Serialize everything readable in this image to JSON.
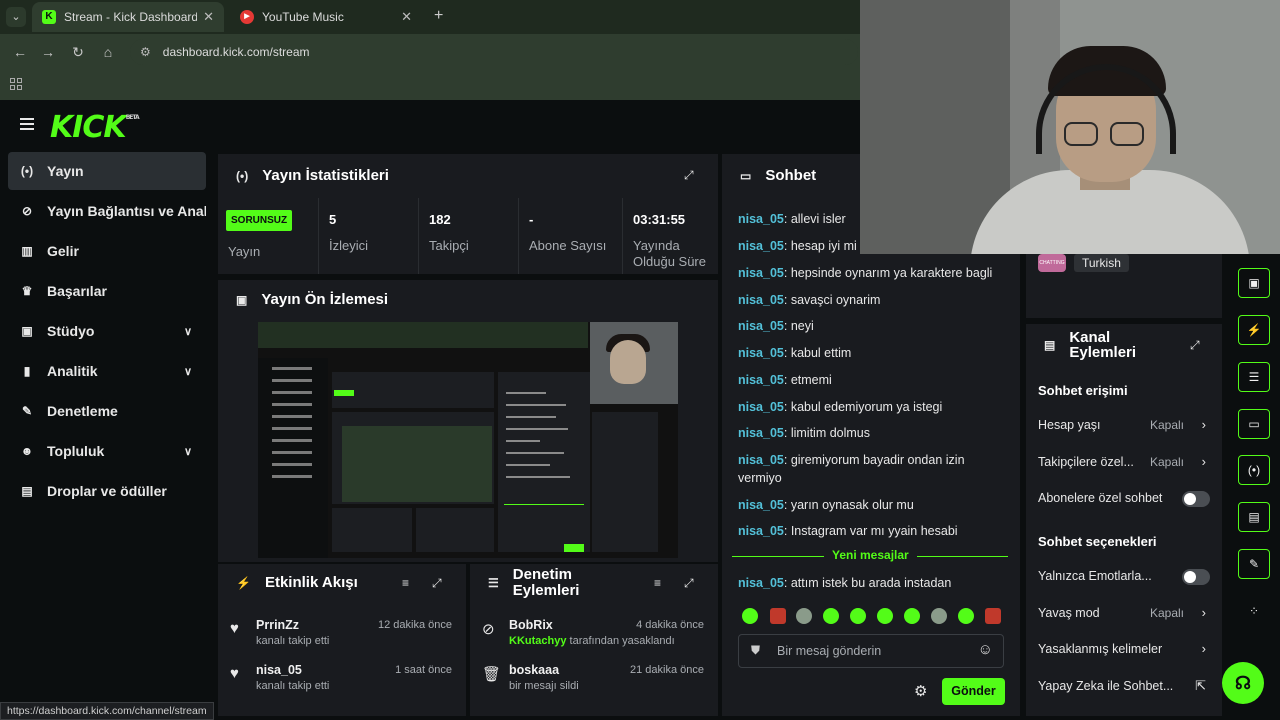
{
  "browser": {
    "tabs": [
      {
        "title": "Stream - Kick Dashboard",
        "favicon": "K",
        "active": true
      },
      {
        "title": "YouTube Music",
        "favicon": "▶",
        "active": false
      }
    ],
    "url": "dashboard.kick.com/stream",
    "status_url": "https://dashboard.kick.com/channel/stream"
  },
  "brand": {
    "logo": "KICK",
    "beta": "BETA",
    "accent": "#53fc18"
  },
  "sidebar": {
    "items": [
      {
        "label": "Yayın",
        "icon": "broadcast-icon",
        "active": true
      },
      {
        "label": "Yayın Bağlantısı ve Anahtarı",
        "icon": "link-icon"
      },
      {
        "label": "Gelir",
        "icon": "revenue-icon"
      },
      {
        "label": "Başarılar",
        "icon": "trophy-icon"
      },
      {
        "label": "Stüdyo",
        "icon": "studio-icon",
        "expandable": true
      },
      {
        "label": "Analitik",
        "icon": "analytics-icon",
        "expandable": true
      },
      {
        "label": "Denetleme",
        "icon": "wrench-icon"
      },
      {
        "label": "Topluluk",
        "icon": "community-icon",
        "expandable": true
      },
      {
        "label": "Droplar ve ödüller",
        "icon": "gift-icon"
      }
    ]
  },
  "stats": {
    "title": "Yayın İstatistikleri",
    "status_badge": "SORUNSUZ",
    "status_label": "Yayın",
    "items": [
      {
        "value": "5",
        "label": "İzleyici"
      },
      {
        "value": "182",
        "label": "Takipçi"
      },
      {
        "value": "-",
        "label": "Abone Sayısı"
      },
      {
        "value": "03:31:55",
        "label": "Yayında Olduğu Süre"
      }
    ]
  },
  "preview": {
    "title": "Yayın Ön İzlemesi"
  },
  "activity": {
    "title": "Etkinlik Akışı",
    "rows": [
      {
        "name": "PrrinZz",
        "action": "kanalı takip etti",
        "time": "12 dakika önce"
      },
      {
        "name": "nisa_05",
        "action": "kanalı takip etti",
        "time": "1 saat önce"
      }
    ]
  },
  "moderation": {
    "title": "Denetim Eylemleri",
    "rows": [
      {
        "name": "BobRix",
        "actor": "KKutachyy",
        "action": "tarafından yasaklandı",
        "time": "4 dakika önce"
      },
      {
        "name": "boskaaa",
        "action": "bir mesajı sildi",
        "time": "21 dakika önce"
      }
    ]
  },
  "chat": {
    "title": "Sohbet",
    "messages": [
      {
        "user": "nisa_05",
        "text": "allevi isler"
      },
      {
        "user": "nisa_05",
        "text": "hesap iyi mi"
      },
      {
        "user": "nisa_05",
        "text": "hepsinde oynarım ya karaktere bagli"
      },
      {
        "user": "nisa_05",
        "text": "savaşci oynarim"
      },
      {
        "user": "nisa_05",
        "text": "neyi"
      },
      {
        "user": "nisa_05",
        "text": "kabul ettim"
      },
      {
        "user": "nisa_05",
        "text": "etmemi"
      },
      {
        "user": "nisa_05",
        "text": "kabul edemiyorum ya istegi"
      },
      {
        "user": "nisa_05",
        "text": "limitim dolmus"
      },
      {
        "user": "nisa_05",
        "text": "giremiyorum bayadir ondan izin vermiyo"
      },
      {
        "user": "nisa_05",
        "text": "yarın oynasak olur mu"
      },
      {
        "user": "nisa_05",
        "text": "Instagram var mı yyain hesabi"
      }
    ],
    "new_messages_label": "Yeni mesajlar",
    "new_messages": [
      {
        "user": "nisa_05",
        "text": "attım istek bu arada instadan"
      }
    ],
    "input_placeholder": "Bir mesaj gönderin",
    "send_label": "Gönder"
  },
  "channel_actions": {
    "language": "Turkish",
    "title": "Kanal Eylemleri",
    "chat_access": {
      "heading": "Sohbet erişimi",
      "rows": [
        {
          "label": "Hesap yaşı",
          "value": "Kapalı"
        },
        {
          "label": "Takipçilere özel...",
          "value": "Kapalı"
        },
        {
          "label": "Abonelere özel sohbet",
          "toggle": false
        }
      ]
    },
    "chat_options": {
      "heading": "Sohbet seçenekleri",
      "rows": [
        {
          "label": "Yalnızca Emotlarla...",
          "toggle": false
        },
        {
          "label": "Yavaş mod",
          "value": "Kapalı"
        },
        {
          "label": "Yasaklanmış kelimeler"
        },
        {
          "label": "Yapay Zeka ile Sohbet..."
        }
      ]
    }
  }
}
